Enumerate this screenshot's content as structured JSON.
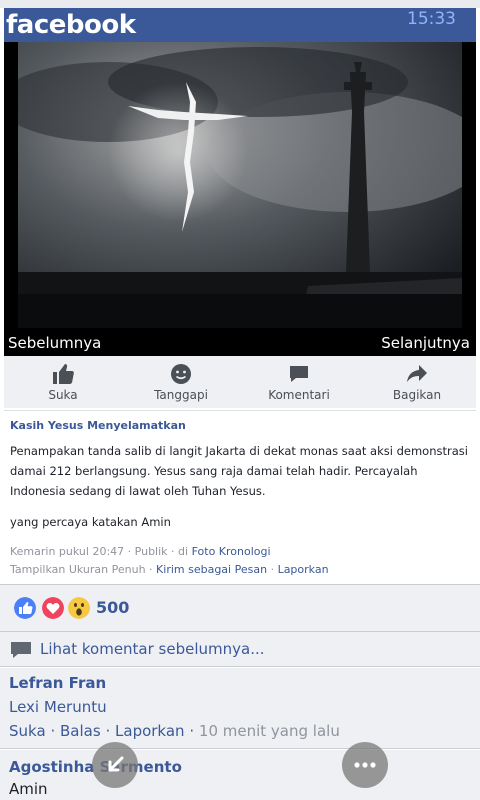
{
  "header": {
    "logo": "facebook",
    "time": "15:33"
  },
  "photo": {
    "prev_label": "Sebelumnya",
    "next_label": "Selanjutnya"
  },
  "actions": [
    {
      "label": "Suka",
      "icon": "like-icon"
    },
    {
      "label": "Tanggapi",
      "icon": "react-icon"
    },
    {
      "label": "Komentari",
      "icon": "comment-icon"
    },
    {
      "label": "Bagikan",
      "icon": "share-icon"
    }
  ],
  "post": {
    "title": "Kasih Yesus Menyelamatkan",
    "body": "Penampakan tanda salib di langit Jakarta di dekat monas saat aksi demonstrasi damai 212 berlangsung. Yesus sang raja damai telah hadir. Percayalah Indonesia sedang di lawat oleh Tuhan Yesus.",
    "amen": "yang percaya katakan Amin",
    "time": "Kemarin pukul 20:47",
    "privacy": "Publik",
    "source_prefix": "di",
    "source": "Foto Kronologi",
    "view_full": "Tampilkan Ukuran Penuh",
    "send_message": "Kirim sebagai Pesan",
    "report": "Laporkan",
    "sep": "·"
  },
  "reactions": {
    "count": "500",
    "types": [
      "like",
      "love",
      "wow"
    ]
  },
  "comments_link": "Lihat komentar sebelumnya...",
  "comments": [
    {
      "name": "Lefran Fran",
      "text": "Lexi Meruntu",
      "like": "Suka",
      "reply": "Balas",
      "report": "Laporkan",
      "ago": "10 menit yang lalu"
    },
    {
      "name": "Agostinha Sarmento",
      "text": "Amin"
    }
  ],
  "colors": {
    "brand": "#3b5998",
    "background": "#eef0f4"
  }
}
